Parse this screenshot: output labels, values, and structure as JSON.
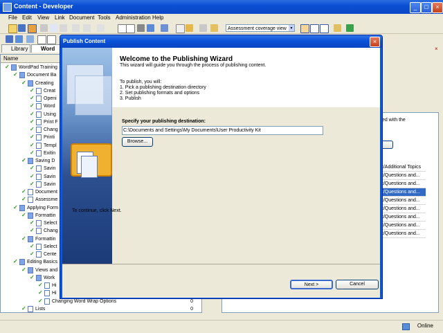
{
  "window": {
    "title": "Content - Developer"
  },
  "menu": [
    "File",
    "Edit",
    "View",
    "Link",
    "Document",
    "Tools",
    "Administration",
    "Help"
  ],
  "toolbar": {
    "view_select": "Assessment coverage view"
  },
  "tabs": {
    "library": "Library",
    "active": "Word"
  },
  "tree": {
    "header": "Name",
    "rows": [
      {
        "label": "WordPad Training",
        "num": ""
      },
      {
        "label": "Document Ba",
        "num": ""
      },
      {
        "label": "Creating",
        "num": ""
      },
      {
        "label": "Creat",
        "num": ""
      },
      {
        "label": "Openi",
        "num": ""
      },
      {
        "label": "Word",
        "num": ""
      },
      {
        "label": "Using",
        "num": ""
      },
      {
        "label": "Print F",
        "num": ""
      },
      {
        "label": "Chang",
        "num": ""
      },
      {
        "label": "Printi",
        "num": ""
      },
      {
        "label": "Templ",
        "num": ""
      },
      {
        "label": "Exitin",
        "num": ""
      },
      {
        "label": "Saving D",
        "num": ""
      },
      {
        "label": "Savin",
        "num": ""
      },
      {
        "label": "Savin",
        "num": ""
      },
      {
        "label": "Savin",
        "num": ""
      },
      {
        "label": "Document",
        "num": ""
      },
      {
        "label": "Assessme",
        "num": ""
      },
      {
        "label": "Applying Form",
        "num": ""
      },
      {
        "label": "Formattin",
        "num": ""
      },
      {
        "label": "Select",
        "num": ""
      },
      {
        "label": "Chang",
        "num": ""
      },
      {
        "label": "Formattin",
        "num": ""
      },
      {
        "label": "Select",
        "num": ""
      },
      {
        "label": "Cente",
        "num": ""
      },
      {
        "label": "Editing Basics",
        "num": ""
      },
      {
        "label": "Views and",
        "num": ""
      },
      {
        "label": "Work",
        "num": ""
      },
      {
        "label": "Hi",
        "num": ""
      },
      {
        "label": "Hi",
        "num": ""
      },
      {
        "label": "Changing Word Wrap Options",
        "num": "0"
      },
      {
        "label": "Lists",
        "num": "0"
      }
    ]
  },
  "right_panel": {
    "text_fragment": "ted with the",
    "cells": [
      "nt/Additional Topics",
      "nt/Questions and...",
      "nt/Questions and...",
      "nt/Questions and...",
      "nt/Questions and...",
      "nt/Questions and...",
      "nt/Questions and...",
      "nt/Questions and...",
      "nt/Questions and..."
    ],
    "selected_index": 3
  },
  "status": {
    "online": "Online"
  },
  "dialog": {
    "title": "Publish Content",
    "heading": "Welcome to the Publishing Wizard",
    "subheading": "This wizard will guide you through the process of publishing content.",
    "intro": "To publish, you will:",
    "steps": [
      "1. Pick a publishing destination directory",
      "2. Set publishing formats and options",
      "3. Publish"
    ],
    "dest_label": "Specify your publishing destination:",
    "dest_value": "C:\\Documents and Settings\\My Documents\\User Productivity Kit",
    "browse": "Browse...",
    "continue_text": "To continue, click Next.",
    "next": "Next >",
    "cancel": "Cancel"
  }
}
